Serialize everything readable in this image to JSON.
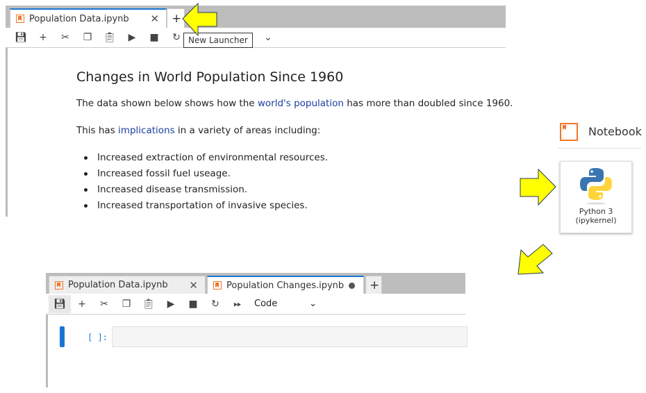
{
  "top_notebook": {
    "tab_title": "Population Data.ipynb",
    "new_tab_label": "+",
    "tooltip": "New Launcher",
    "toolbar": [
      "save-icon",
      "add-icon",
      "cut-icon",
      "copy-icon",
      "paste-icon",
      "run-icon",
      "stop-icon",
      "restart-icon"
    ],
    "heading": "Changes in World Population Since 1960",
    "para1_before": "The data shown below shows how the ",
    "para1_link": "world's population",
    "para1_after": " has more than doubled since 1960.",
    "para2_before": "This has ",
    "para2_link": "implications",
    "para2_after": " in a variety of areas including:",
    "bullets": [
      "Increased extraction of environmental resources.",
      "Increased fossil fuel useage.",
      "Increased disease transmission.",
      "Increased transportation of invasive species."
    ]
  },
  "launcher": {
    "section_title": "Notebook",
    "kernel_name": "Python 3",
    "kernel_sub": "(ipykernel)"
  },
  "bottom_notebook": {
    "tabs": [
      {
        "title": "Population Data.ipynb",
        "active": false
      },
      {
        "title": "Population Changes.ipynb",
        "active": true,
        "unsaved": true
      }
    ],
    "new_tab_label": "+",
    "cell_type": "Code",
    "prompt": "[ ]:"
  },
  "colors": {
    "accent": "#1976d2",
    "notebook_orange": "#f37726",
    "arrow": "#ffff00"
  }
}
